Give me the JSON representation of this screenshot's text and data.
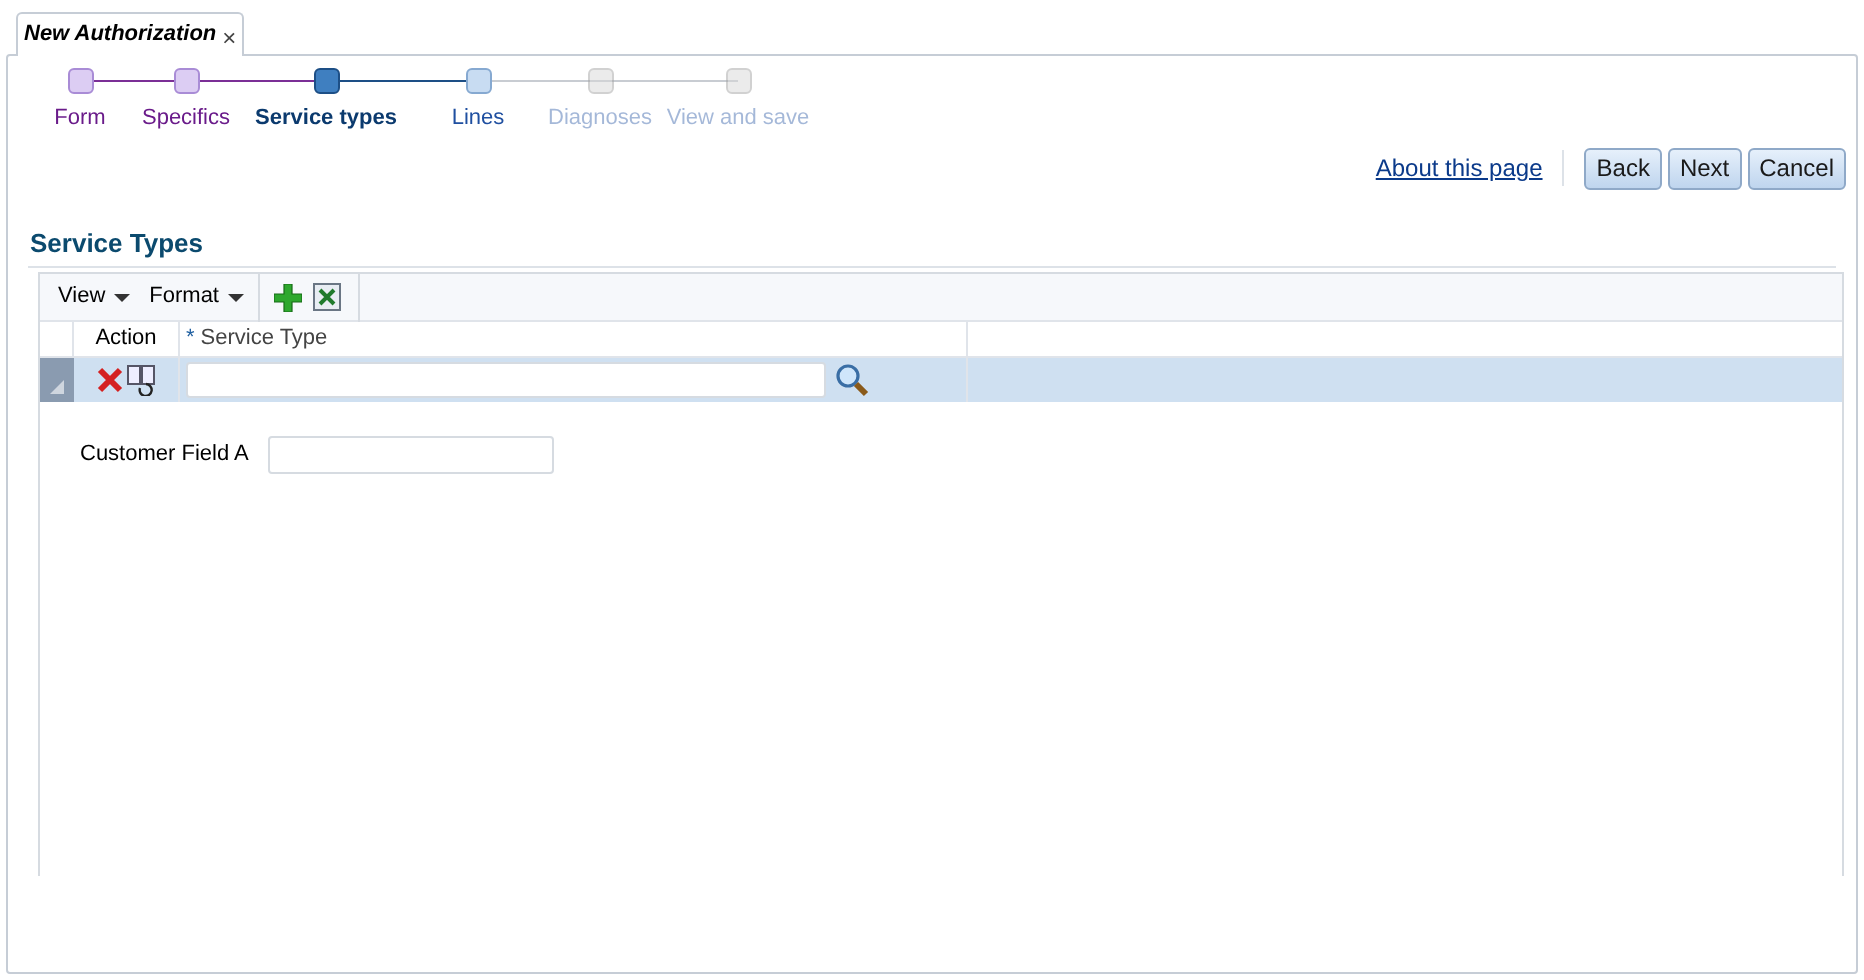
{
  "tab": {
    "title": "New Authorization",
    "close": "×"
  },
  "train": [
    {
      "label": "Form",
      "visited": true,
      "selected": false,
      "disabled": false
    },
    {
      "label": "Specifics",
      "visited": true,
      "selected": false,
      "disabled": false
    },
    {
      "label": "Service types",
      "visited": false,
      "selected": true,
      "disabled": false
    },
    {
      "label": "Lines",
      "visited": false,
      "selected": false,
      "disabled": false
    },
    {
      "label": "Diagnoses",
      "visited": false,
      "selected": false,
      "disabled": true
    },
    {
      "label": "View and save",
      "visited": false,
      "selected": false,
      "disabled": true
    }
  ],
  "about_link": "About this page",
  "buttons": [
    "Back",
    "Next",
    "Cancel"
  ],
  "section_title": "Service Types",
  "toolbar": {
    "menus": [
      "View",
      "Format"
    ]
  },
  "table": {
    "columns": [
      "Action",
      "Service Type"
    ],
    "required_mark": "*",
    "rows": [
      {
        "selected": true
      }
    ]
  },
  "customer_field": {
    "label": "Customer Field A"
  }
}
